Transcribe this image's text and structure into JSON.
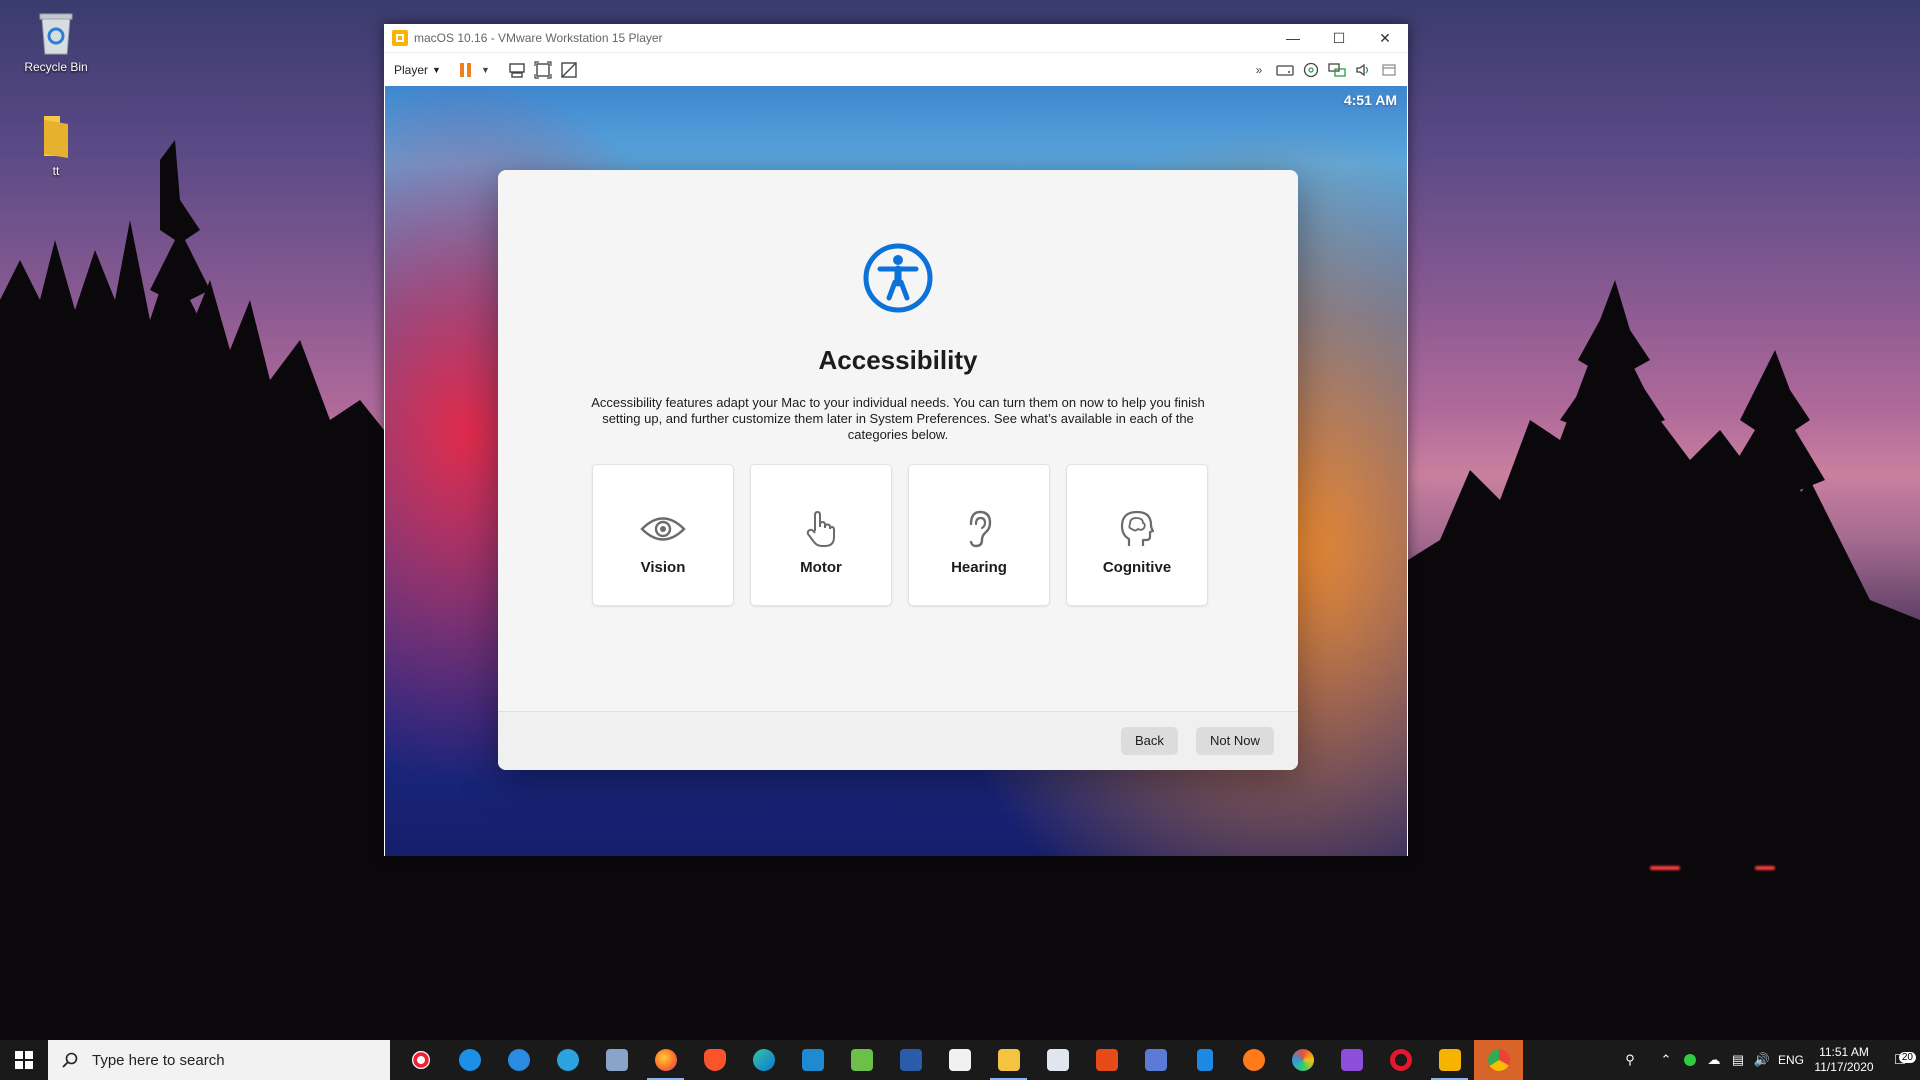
{
  "desktop": {
    "icons": [
      {
        "label": "Recycle Bin"
      },
      {
        "label": "tt"
      }
    ]
  },
  "vmware": {
    "title": "macOS 10.16 - VMware Workstation 15 Player",
    "menu": {
      "player_label": "Player"
    },
    "guest": {
      "clock": "4:51 AM",
      "dialog": {
        "title": "Accessibility",
        "description": "Accessibility features adapt your Mac to your individual needs. You can turn them on now to help you finish setting up, and further customize them later in System Preferences. See what’s available in each of the categories below.",
        "categories": [
          {
            "label": "Vision",
            "icon": "eye-icon"
          },
          {
            "label": "Motor",
            "icon": "hand-pointer-icon"
          },
          {
            "label": "Hearing",
            "icon": "ear-icon"
          },
          {
            "label": "Cognitive",
            "icon": "brain-head-icon"
          }
        ],
        "back_label": "Back",
        "not_now_label": "Not Now"
      }
    }
  },
  "taskbar": {
    "search_placeholder": "Type here to search",
    "language": "ENG",
    "time": "11:51 AM",
    "date": "11/17/2020",
    "notification_count": "20"
  },
  "colors": {
    "accent_blue": "#0a72d8",
    "pause_orange": "#f0801c",
    "taskbar_bg": "#1a1a1a"
  }
}
